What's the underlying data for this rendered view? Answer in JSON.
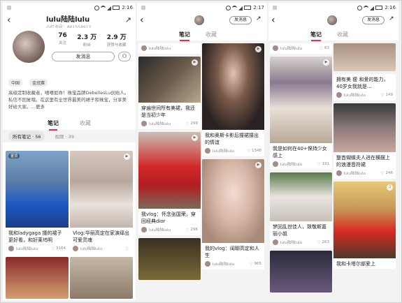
{
  "status": {
    "time1": "2:16",
    "time2": "2:17",
    "time3": "2:16",
    "battery": "73"
  },
  "profile": {
    "nickname": "lulu陆陆lulu",
    "id_text": "小红书号：861558912",
    "stats": [
      {
        "num": "76",
        "label": "关注"
      },
      {
        "num": "2.3 万",
        "label": "粉丝"
      },
      {
        "num": "2.9 万",
        "label": "获赞与收藏"
      }
    ],
    "message_button": "发消息",
    "location": "中国",
    "brand_badge": "金冠赛",
    "bio": "高级定制收藏者，嘻嘻如命！珠宝品牌DebellesLu创始人。私信不回复哦。在这里有全世界最美的裙子和珠宝，分享美好给大家。…更多"
  },
  "tabs": {
    "notes": "笔记",
    "collect": "收藏"
  },
  "filters": {
    "all": "所有笔记 · 56",
    "video": "视频 · 39"
  },
  "small_message_button": "发消息",
  "author": "lulu陆陆lulu",
  "panel1_cards": [
    {
      "badge": "置顶",
      "title": "我和ladygaga 撞的裙子更好看，和好莱坞明",
      "likes": "3164"
    },
    {
      "title": "Vlog:华丽高定在家演绎出可爱灵魂",
      "likes": ""
    }
  ],
  "panel2_cards": [
    {
      "title": "",
      "likes": ""
    },
    {
      "title": "穿遍世间所有美裙，我还是当初少年",
      "likes": "299"
    },
    {
      "title": "我vlog：怀念张国荣，穿回经典dior",
      "likes": "296"
    },
    {
      "title": "",
      "likes": ""
    },
    {
      "title": "我和奥斯卡影后撞裙撞出的情谊",
      "likes": "1348"
    },
    {
      "title": "我的vlog：闺聊高定和人生",
      "likes": "965"
    }
  ],
  "panel3_cards": [
    {
      "title": "",
      "likes": "63"
    },
    {
      "title": "我是如何在40+保持少女感上",
      "likes": "191"
    },
    {
      "title": "梦回乱世佳人，致敬斯嘉丽小姐",
      "likes": "263"
    },
    {
      "title": "拥有美 瘦 和爱的能力，40岁女我就是…",
      "likes": "149"
    },
    {
      "title": "整首蝴蝶夫人进在横摆上的浪漫音符裙",
      "likes": "246"
    },
    {
      "title": "我和卡塔尔部爱上",
      "likes": ""
    }
  ],
  "colors": {
    "accent": "#ff2442"
  },
  "icons": [
    "back-icon",
    "share-icon",
    "add-follow-icon",
    "play-icon",
    "heart-icon"
  ]
}
